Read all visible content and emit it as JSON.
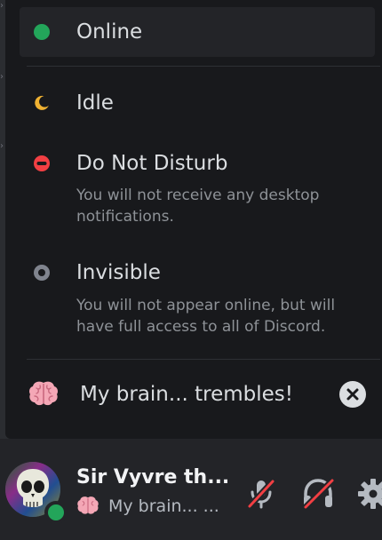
{
  "status_menu": {
    "items": [
      {
        "key": "online",
        "label": "Online",
        "description": "",
        "color": "#23a55a",
        "selected": true
      },
      {
        "key": "idle",
        "label": "Idle",
        "description": "",
        "color": "#f0b232",
        "selected": false
      },
      {
        "key": "dnd",
        "label": "Do Not Disturb",
        "description": "You will not receive any desktop notifications.",
        "color": "#f23f43",
        "selected": false
      },
      {
        "key": "invisible",
        "label": "Invisible",
        "description": "You will not appear online, but will have full access to all of Discord.",
        "color": "#80848e",
        "selected": false
      }
    ]
  },
  "custom_status": {
    "emoji": "brain-emoji",
    "text": "My brain... trembles!",
    "clear_icon": "clear-x-icon"
  },
  "user_panel": {
    "username": "Sir Vyvre th...",
    "status_text": "My brain... ...",
    "status_emoji": "brain-emoji",
    "presence": "online",
    "presence_color": "#23a55a",
    "buttons": [
      {
        "name": "mute-microphone",
        "icon": "microphone-muted-icon",
        "state": "muted",
        "color": "#f23f43"
      },
      {
        "name": "deafen",
        "icon": "headphones-deafened-icon",
        "state": "deafened",
        "color": "#f23f43"
      },
      {
        "name": "user-settings",
        "icon": "gear-icon"
      }
    ]
  },
  "theme": {
    "popout_bg": "#18191c",
    "panel_bg": "#232428",
    "text_primary": "#dbdee1",
    "text_muted": "#8e9297",
    "danger": "#f23f43"
  }
}
